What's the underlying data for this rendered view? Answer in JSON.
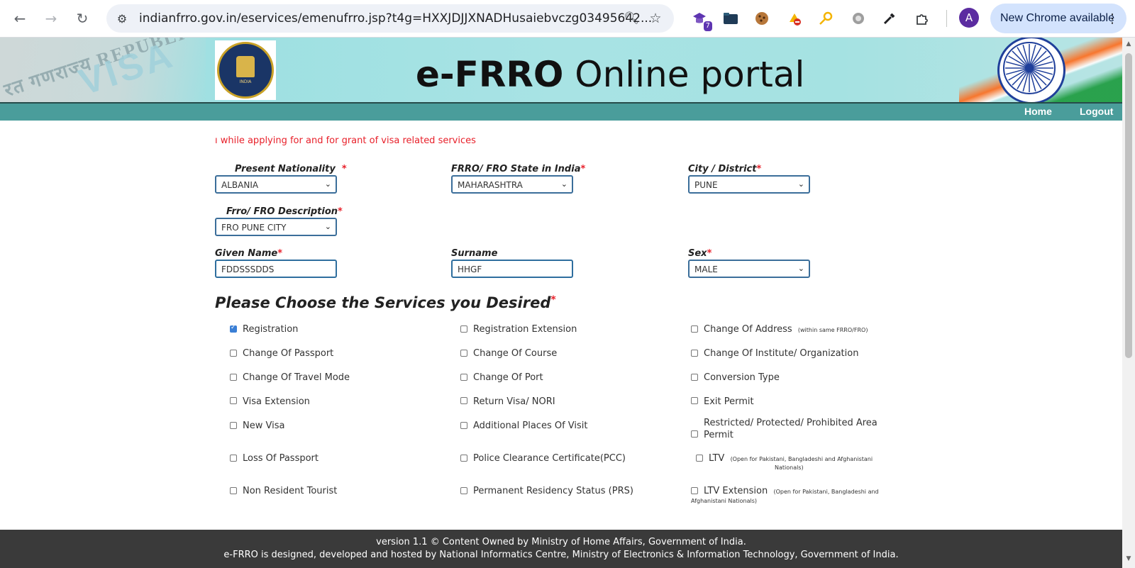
{
  "browser": {
    "url": "indianfrro.gov.in/eservices/emenufrro.jsp?t4g=HXXJDJJXNADHusaiebvczg03495642...",
    "extension_badge": "7",
    "profile_initial": "A",
    "new_chrome_label": "New Chrome available"
  },
  "banner": {
    "title_bold": "e-FRRO",
    "title_rest": " Online portal",
    "visa_stamp_line": "रत गणराज्य REPUBLIC OF",
    "visa_stamp_word": "VISA",
    "emblem_text": "INDIA"
  },
  "nav": {
    "home": "Home",
    "logout": "Logout"
  },
  "marquee_text": "ı while applying for and for grant of visa related services",
  "form": {
    "nationality": {
      "label": "Present Nationality",
      "value": "ALBANIA"
    },
    "state": {
      "label": "FRRO/ FRO State in India",
      "value": "MAHARASHTRA"
    },
    "city": {
      "label": "City / District",
      "value": "PUNE"
    },
    "frro_desc": {
      "label": "Frro/ FRO Description",
      "value": "FRO PUNE CITY"
    },
    "given_name": {
      "label": "Given Name",
      "value": "FDDSSSDDS"
    },
    "surname": {
      "label": "Surname",
      "value": "HHGF"
    },
    "sex": {
      "label": "Sex",
      "value": "MALE"
    },
    "required_mark": "*"
  },
  "services": {
    "title": "Please Choose the Services you Desired",
    "items": [
      {
        "label": "Registration",
        "checked": true
      },
      {
        "label": "Registration Extension",
        "checked": false
      },
      {
        "label": "Change Of Address",
        "note": "(within same FRRO/FRO)",
        "checked": false
      },
      {
        "label": "Change Of Passport",
        "checked": false
      },
      {
        "label": "Change Of Course",
        "checked": false
      },
      {
        "label": "Change Of Institute/ Organization",
        "checked": false
      },
      {
        "label": "Change Of Travel Mode",
        "checked": false
      },
      {
        "label": "Change Of Port",
        "checked": false
      },
      {
        "label": "Conversion Type",
        "checked": false
      },
      {
        "label": "Visa Extension",
        "checked": false
      },
      {
        "label": "Return Visa/ NORI",
        "checked": false
      },
      {
        "label": "Exit Permit",
        "checked": false
      },
      {
        "label": "New Visa",
        "checked": false
      },
      {
        "label": "Additional Places Of Visit",
        "checked": false
      },
      {
        "label": "Restricted/ Protected/ Prohibited Area",
        "label2": "Permit",
        "checked": false
      },
      {
        "label": "Loss Of Passport",
        "checked": false
      },
      {
        "label": "Police Clearance Certificate(PCC)",
        "checked": false
      },
      {
        "label": "LTV",
        "note": "(Open for Pakistani, Bangladeshi and Afghanistani",
        "note2": "Nationals)",
        "checked": false
      },
      {
        "label": "Non Resident Tourist",
        "checked": false
      },
      {
        "label": "Permanent Residency Status (PRS)",
        "checked": false
      },
      {
        "label": "LTV Extension",
        "note": "(Open for Pakistani, Bangladeshi and",
        "note2": "Afghanistani Nationals)",
        "checked": false
      }
    ]
  },
  "footer": {
    "line1": "version 1.1 © Content Owned by Ministry of Home Affairs, Government of India.",
    "line2": "e-FRRO is designed, developed and hosted by National Informatics Centre, Ministry of Electronics & Information Technology, Government of India."
  },
  "colors": {
    "nav_bar": "#4a9d9b",
    "required": "#e8202a",
    "input_border": "#3b6e9a",
    "footer": "#3a3a3a"
  }
}
